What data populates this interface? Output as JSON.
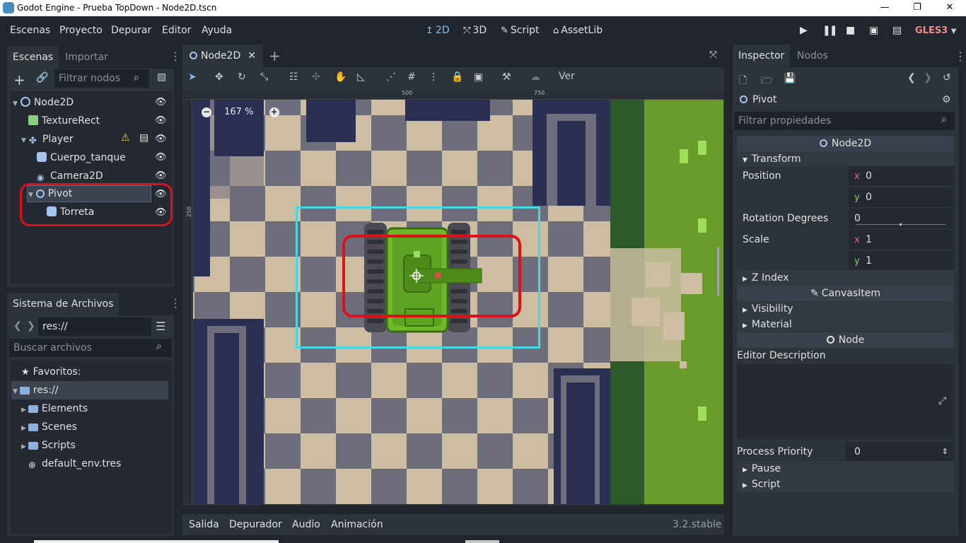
{
  "window": {
    "title": "Godot Engine - Prueba TopDown - Node2D.tscn",
    "minimize": "—",
    "maximize": "❐",
    "close": "✕"
  },
  "menu": [
    "Escenas",
    "Proyecto",
    "Depurar",
    "Editor",
    "Ayuda"
  ],
  "workspaces": [
    {
      "label": "2D",
      "icon": "↥"
    },
    {
      "label": "3D",
      "icon": "⤲"
    },
    {
      "label": "Script",
      "icon": "✎"
    },
    {
      "label": "AssetLib",
      "icon": "⌂"
    }
  ],
  "renderer": "GLES3",
  "scene_dock": {
    "tabs": [
      "Escenas",
      "Importar"
    ],
    "filter_placeholder": "Filtrar nodos",
    "nodes": [
      {
        "label": "Node2D",
        "icon": "node2d-icon",
        "warning": false,
        "script": false
      },
      {
        "label": "TextureRect",
        "icon": "texturerect-icon",
        "warning": false,
        "script": false
      },
      {
        "label": "Player",
        "icon": "kinematic-icon",
        "warning": true,
        "script": true
      },
      {
        "label": "Cuerpo_tanque",
        "icon": "sprite-icon",
        "warning": false,
        "script": false
      },
      {
        "label": "Camera2D",
        "icon": "camera-icon",
        "warning": false,
        "script": false
      },
      {
        "label": "Pivot",
        "icon": "node2d-icon",
        "warning": false,
        "script": false
      },
      {
        "label": "Torreta",
        "icon": "sprite-icon",
        "warning": false,
        "script": false
      }
    ]
  },
  "filesystem": {
    "title": "Sistema de Archivos",
    "path": "res://",
    "search_placeholder": "Buscar archivos",
    "favorites": "Favoritos:",
    "items": [
      {
        "label": "res://"
      },
      {
        "label": "Elements"
      },
      {
        "label": "Scenes"
      },
      {
        "label": "Scripts"
      },
      {
        "label": "default_env.tres"
      }
    ]
  },
  "editor_tab": {
    "label": "Node2D"
  },
  "viewport": {
    "zoom": "167 %",
    "ruler_labels": {
      "h500": "500",
      "h750": "750",
      "v250": "250"
    },
    "toolbar_view": "Ver"
  },
  "bottom": {
    "tabs": [
      "Salida",
      "Depurador",
      "Audio",
      "Animación"
    ],
    "version": "3.2.stable"
  },
  "inspector": {
    "tabs": [
      "Inspector",
      "Nodos"
    ],
    "node": "Pivot",
    "filter_placeholder": "Filtrar propiedades",
    "class_node2d": "Node2D",
    "transform": "Transform",
    "position": "Position",
    "pos_x": "0",
    "pos_y": "0",
    "rotation": "Rotation Degrees",
    "rotation_val": "0",
    "scale": "Scale",
    "scale_x": "1",
    "scale_y": "1",
    "z_index": "Z Index",
    "class_canvas": "CanvasItem",
    "visibility": "Visibility",
    "material": "Material",
    "class_node": "Node",
    "editor_description": "Editor Description",
    "process_priority": "Process Priority",
    "priority_val": "0",
    "pause": "Pause",
    "script": "Script",
    "x": "x",
    "y": "y"
  }
}
